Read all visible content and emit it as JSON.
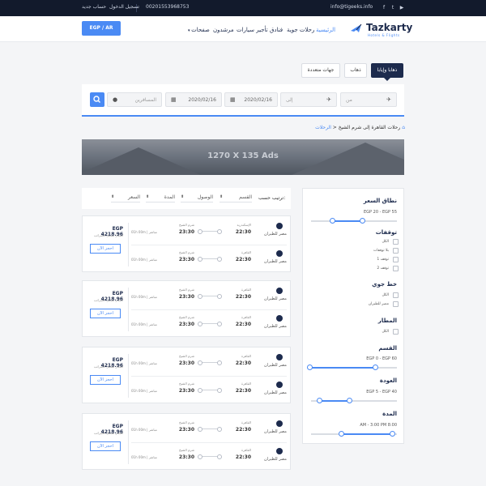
{
  "topbar": {
    "email": "info@tigeeks.info",
    "phone": "00201553968753",
    "login": "تسجيل الدخول",
    "new_account": "حساب جديد",
    "social_icons": [
      "facebook-icon",
      "twitter-icon",
      "youtube-icon"
    ]
  },
  "header": {
    "logo_name": "Tazkarty",
    "logo_sub": "Hotels & Flights",
    "nav": [
      "الرئيسية",
      "رحلات جوية",
      "فنادق",
      "تأجير سيارات",
      "مرشدون",
      "صفحات"
    ],
    "lang_button": "EGP / AR"
  },
  "tabs": [
    "ذهابا وإيابا",
    "ذهاب",
    "جهات متعددة"
  ],
  "search": {
    "from_placeholder": "من",
    "to_placeholder": "إلى",
    "depart_date": "2020/02/16",
    "return_date": "2020/02/16",
    "travelers_placeholder": "المسافرين"
  },
  "breadcrumb": {
    "home": "الرحلات",
    "current": "رحلات القاهرة إلى شرم الشيخ"
  },
  "ad": {
    "text": "1270 X 135 Ads"
  },
  "sort": {
    "label": "ترتيب حسب:",
    "options": [
      "القسم",
      "الوصول",
      "المدة",
      "السعر"
    ]
  },
  "cards": [
    {
      "price": "EGP 4218.96",
      "price_note": "أسعار تشمل الضرائب",
      "book": "احجز الآن",
      "legs": [
        {
          "airline": "مصر للطيران",
          "dep_city": "الإسكندرية",
          "dep_time": "22:30",
          "arr_city": "شرم الشيخ",
          "arr_time": "23:30",
          "duration": "01h 00m | مباشر"
        },
        {
          "airline": "مصر للطيران",
          "dep_city": "القاهرة",
          "dep_time": "22:30",
          "arr_city": "شرم الشيخ",
          "arr_time": "23:30",
          "duration": "01h 00m | مباشر"
        }
      ]
    },
    {
      "price": "EGP 4218.96",
      "price_note": "أسعار تشمل الضرائب",
      "book": "احجز الآن",
      "legs": [
        {
          "airline": "مصر للطيران",
          "dep_city": "القاهرة",
          "dep_time": "22:30",
          "arr_city": "شرم الشيخ",
          "arr_time": "23:30",
          "duration": "01h 00m | مباشر"
        },
        {
          "airline": "مصر للطيران",
          "dep_city": "القاهرة",
          "dep_time": "22:30",
          "arr_city": "شرم الشيخ",
          "arr_time": "23:30",
          "duration": "01h 00m | مباشر"
        }
      ]
    },
    {
      "price": "EGP 4218.96",
      "price_note": "أسعار تشمل الضرائب",
      "book": "احجز الآن",
      "legs": [
        {
          "airline": "مصر للطيران",
          "dep_city": "القاهرة",
          "dep_time": "22:30",
          "arr_city": "شرم الشيخ",
          "arr_time": "23:30",
          "duration": "01h 00m | مباشر"
        },
        {
          "airline": "مصر للطيران",
          "dep_city": "القاهرة",
          "dep_time": "22:30",
          "arr_city": "شرم الشيخ",
          "arr_time": "23:30",
          "duration": "01h 00m | مباشر"
        }
      ]
    },
    {
      "price": "EGP 4218.96",
      "price_note": "أسعار تشمل الضرائب",
      "book": "احجز الآن",
      "legs": [
        {
          "airline": "مصر للطيران",
          "dep_city": "القاهرة",
          "dep_time": "22:30",
          "arr_city": "شرم الشيخ",
          "arr_time": "23:30",
          "duration": "01h 00m | مباشر"
        },
        {
          "airline": "مصر للطيران",
          "dep_city": "القاهرة",
          "dep_time": "22:30",
          "arr_city": "شرم الشيخ",
          "arr_time": "23:30",
          "duration": "01h 00m | مباشر"
        }
      ]
    }
  ],
  "filters": {
    "price": {
      "title": "نطاق السعر",
      "range": "EGP 20 - EGP 55",
      "low": 0.25,
      "high": 0.6
    },
    "stops": {
      "title": "توقفات",
      "options": [
        "الكل",
        "بلا توقفات",
        "1 توقف",
        "2 توقف"
      ]
    },
    "airline": {
      "title": "خط جوي",
      "options": [
        "الكل",
        "مصر للطيران"
      ]
    },
    "airport": {
      "title": "المطار",
      "options": [
        "الكل"
      ]
    },
    "section": {
      "title": "القسم",
      "range": "EGP 0 - EGP 60",
      "low": 0.0,
      "high": 0.75
    },
    "return": {
      "title": "العودة",
      "range": "EGP 5 - EGP 40",
      "low": 0.1,
      "high": 0.45
    },
    "duration": {
      "title": "المدة",
      "range": "AM - 3:00 PM 8:00",
      "low": 0.35,
      "high": 0.95
    }
  },
  "colors": {
    "accent": "#4a8af4",
    "navy": "#1d2b4d",
    "topbar": "#121a2c"
  }
}
